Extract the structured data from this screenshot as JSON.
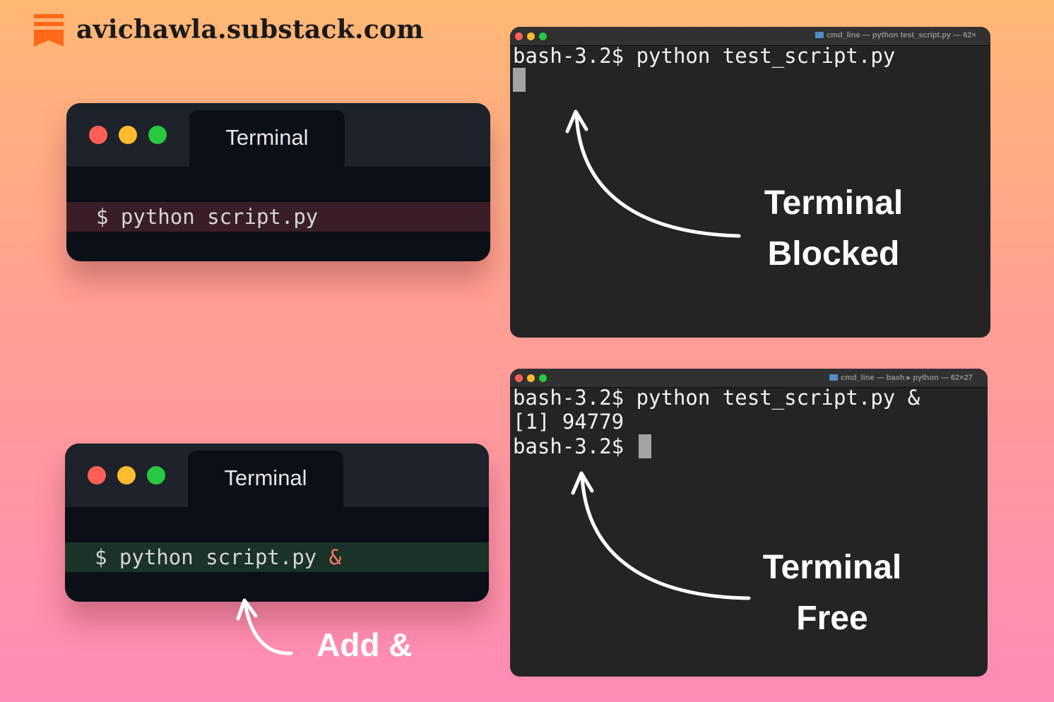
{
  "brand": {
    "name": "avichawla.substack.com",
    "logo_icon": "substack-logo-icon",
    "logo_color": "#ff6719"
  },
  "cards": [
    {
      "tab_label": "Terminal",
      "command": "$ python script.py",
      "ampersand": "",
      "highlight_color": "#3a1e27"
    },
    {
      "tab_label": "Terminal",
      "command": "$ python script.py",
      "ampersand": " &",
      "highlight_color": "#1a3227"
    }
  ],
  "terminals": [
    {
      "window_title": "cmd_line — python test_script.py — 62×",
      "lines": [
        "bash-3.2$ python test_script.py"
      ],
      "annotation": [
        "Terminal",
        "Blocked"
      ]
    },
    {
      "window_title": "cmd_line — bash ▸ python — 62×27",
      "lines": [
        "bash-3.2$ python test_script.py &",
        "[1] 94779",
        "bash-3.2$"
      ],
      "annotation": [
        "Terminal",
        "Free"
      ]
    }
  ],
  "callout": "Add &",
  "colors": {
    "red": "#ff5f57",
    "yellow": "#febc2e",
    "green": "#28c840"
  }
}
